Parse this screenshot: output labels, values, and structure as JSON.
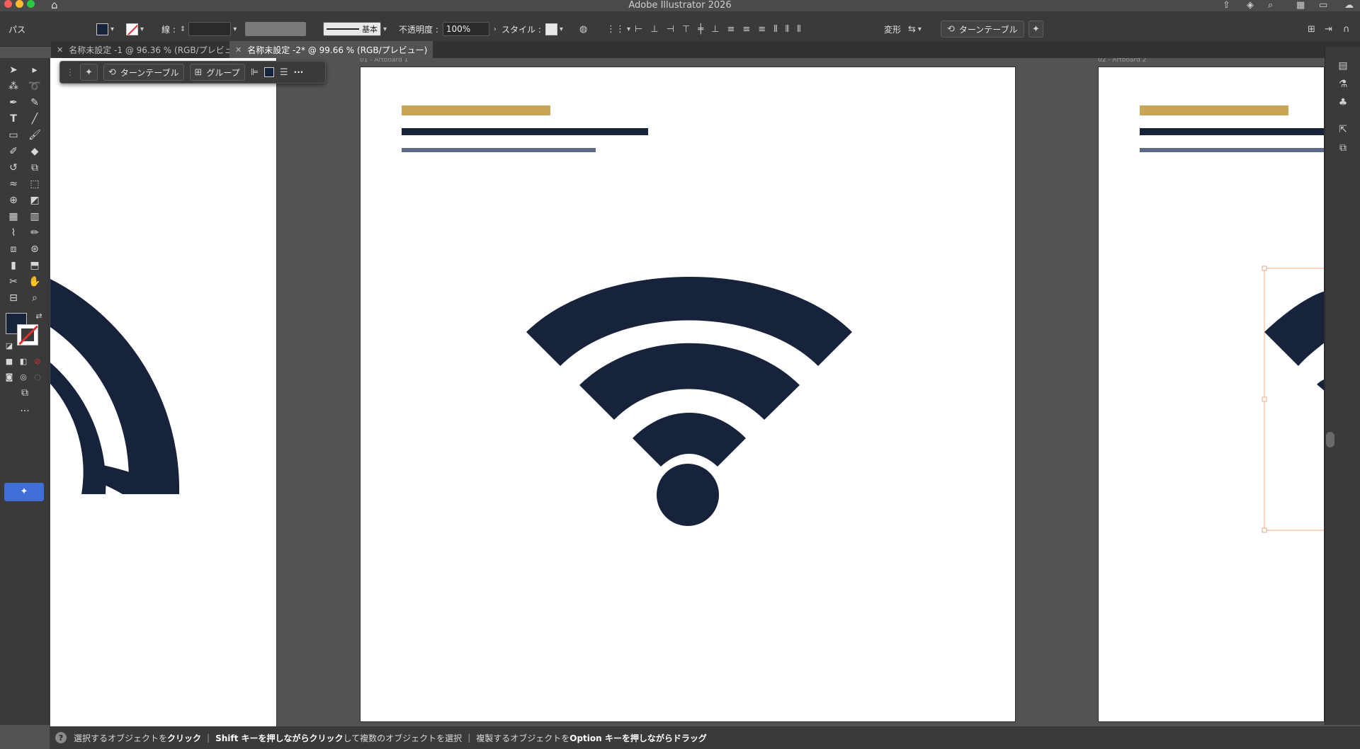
{
  "window": {
    "title": "Adobe Illustrator 2026"
  },
  "control_bar": {
    "selection_label": "パス",
    "stroke_label": "線 :",
    "stroke_profile": "基本",
    "opacity_label": "不透明度 :",
    "opacity_value": "100%",
    "style_label": "スタイル :",
    "transform_label": "変形",
    "turntable_label": "ターンテーブル"
  },
  "tabs": [
    {
      "label": "名称未設定 -1 @ 96.36 % (RGB/プレビュー)",
      "active": false
    },
    {
      "label": "名称未設定 -2* @ 99.66 % (RGB/プレビュー)",
      "active": true
    }
  ],
  "context_bar": {
    "turntable_label": "ターンテーブル",
    "group_label": "グループ",
    "more_label": "···"
  },
  "artboards": {
    "center_label": "01 - Artboard 1",
    "right_label": "02 - Artboard 2"
  },
  "status_bar": {
    "t1": "選択するオブジェクトを",
    "t1b": "クリック",
    "t2": "Shift キーを押しながら",
    "t2b": "クリック",
    "t3": "して複数のオブジェクトを選択",
    "t4": "複製するオブジェクトを",
    "t4b": "Option キーを押しながらドラッグ"
  },
  "colors": {
    "navy": "#17223b",
    "gold": "#c9a657",
    "slate": "#5b6a86",
    "selection": "#f2a88a"
  },
  "icons": {
    "home": "home-icon",
    "wifi": "wifi-icon",
    "turntable": "turntable-icon",
    "group": "group-icon"
  }
}
